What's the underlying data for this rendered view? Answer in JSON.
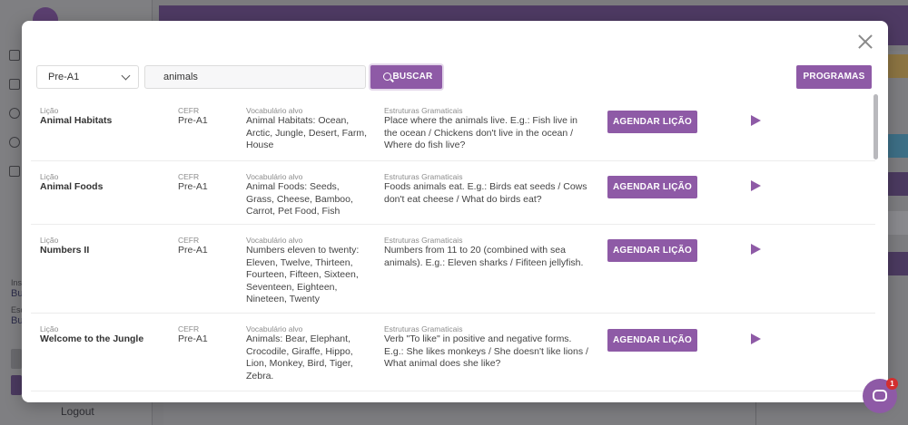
{
  "background": {
    "sidebar_labels": [
      "Ins",
      "Bu",
      "Esc",
      "Bu"
    ],
    "logout": "Logout"
  },
  "modal": {
    "level_select": {
      "value": "Pre-A1"
    },
    "search": {
      "value": "animals"
    },
    "search_button": "BUSCAR",
    "programs_button": "PROGRAMAS",
    "column_labels": {
      "lesson": "Lição",
      "cefr": "CEFR",
      "vocab": "Vocabulário alvo",
      "structures": "Estruturas Gramaticais"
    },
    "schedule_label": "AGENDAR LIÇÃO",
    "lessons": [
      {
        "title": "Animal Habitats",
        "cefr": "Pre-A1",
        "vocab": "Animal Habitats: Ocean, Arctic, Jungle, Desert, Farm, House",
        "structures": "Place where the animals live. E.g.: Fish live in the ocean / Chickens don't live in the ocean / Where do fish live?"
      },
      {
        "title": "Animal Foods",
        "cefr": "Pre-A1",
        "vocab": "Animal Foods: Seeds, Grass, Cheese, Bamboo, Carrot, Pet Food, Fish",
        "structures": "Foods animals eat. E.g.: Birds eat seeds / Cows don't eat cheese / What do birds eat?"
      },
      {
        "title": "Numbers II",
        "cefr": "Pre-A1",
        "vocab": "Numbers eleven to twenty: Eleven, Twelve, Thirteen, Fourteen, Fifteen, Sixteen, Seventeen, Eighteen, Nineteen, Twenty",
        "structures": "Numbers from 11 to 20 (combined with sea animals). E.g.: Eleven sharks / Fifiteen jellyfish."
      },
      {
        "title": "Welcome to the Jungle",
        "cefr": "Pre-A1",
        "vocab": "Animals: Bear, Elephant, Crocodile, Giraffe, Hippo, Lion, Monkey, Bird, Tiger, Zebra.",
        "structures": "Verb \"To like\" in positive and negative forms. E.g.: She likes monkeys / She doesn't like lions / What animal does she like?"
      }
    ]
  },
  "chat": {
    "badge_count": "1"
  },
  "colors": {
    "accent": "#8e5aa6",
    "badge": "#d32f2f"
  }
}
